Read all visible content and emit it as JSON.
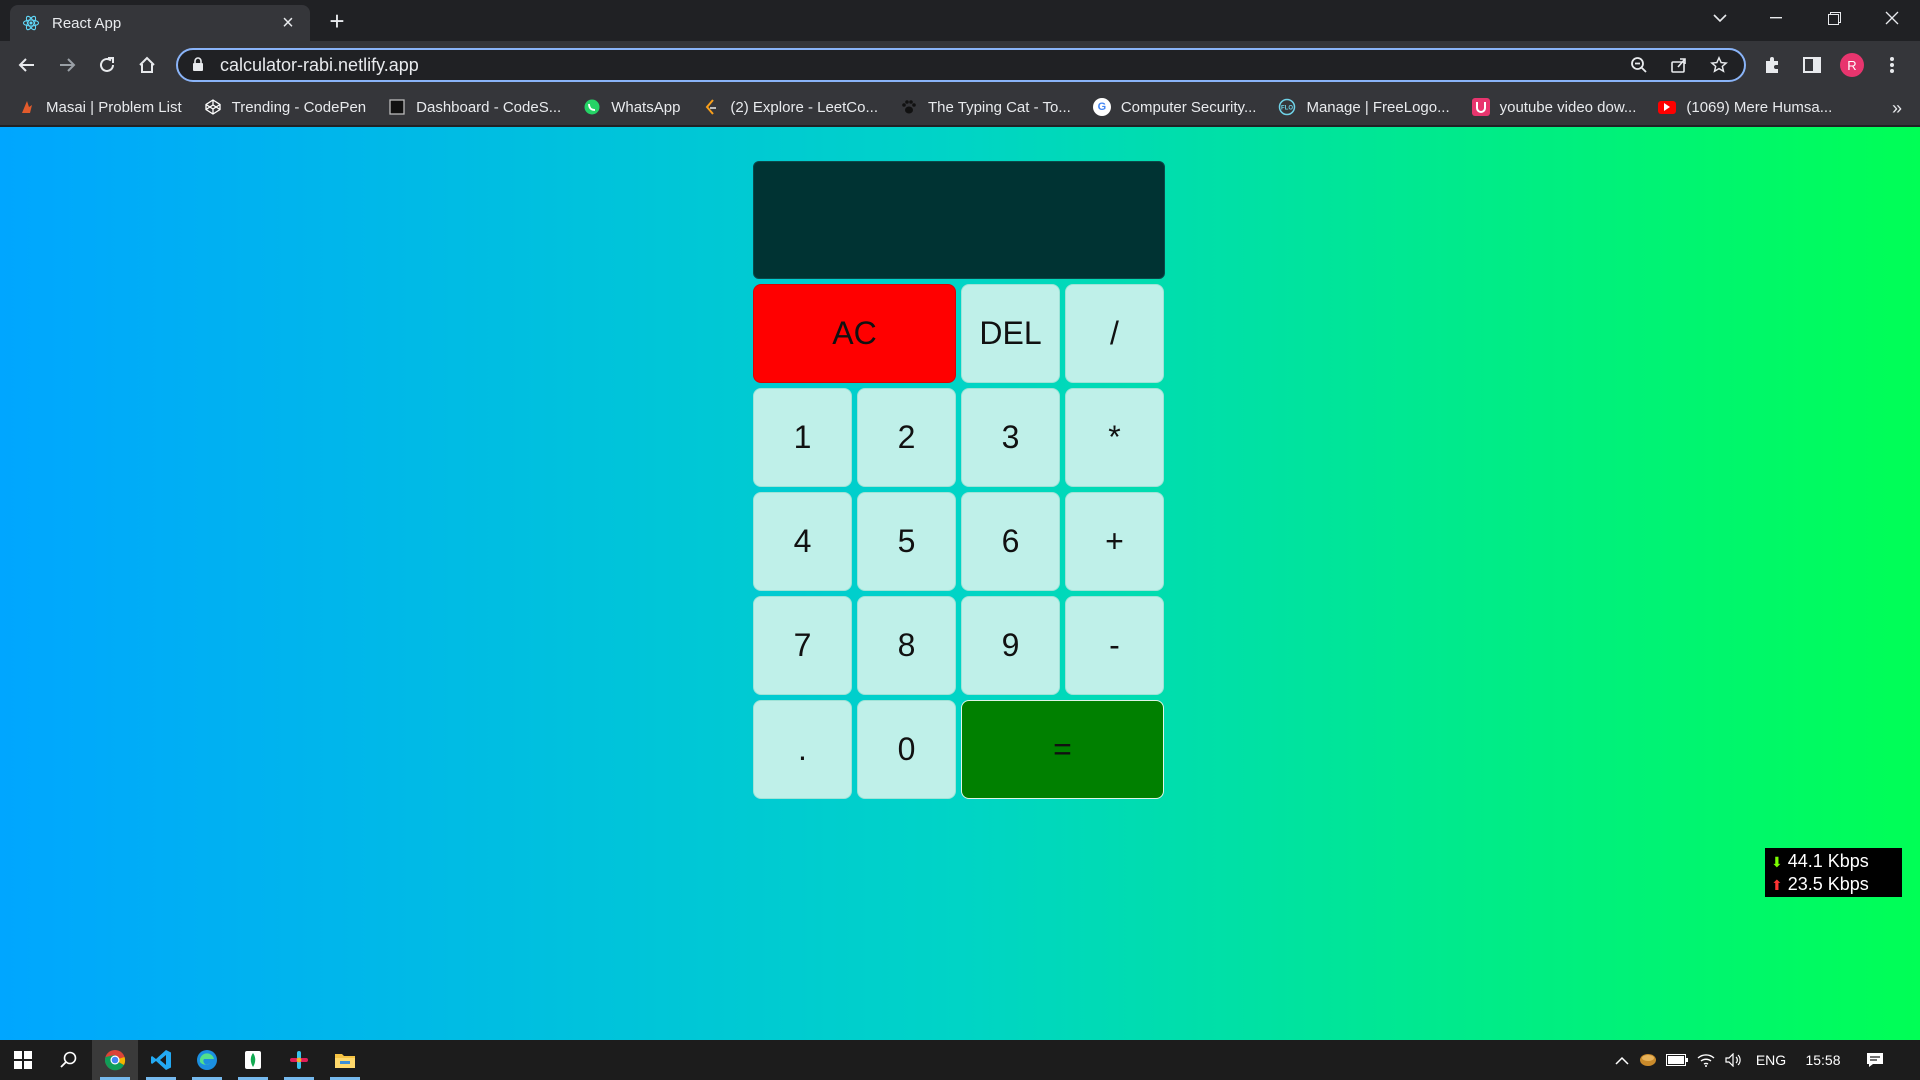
{
  "browser": {
    "tab_title": "React App",
    "url": "calculator-rabi.netlify.app",
    "profile_initial": "R"
  },
  "bookmarks": [
    {
      "label": "Masai | Problem List",
      "icon": "masai-icon",
      "color": "#e25b2c"
    },
    {
      "label": "Trending - CodePen",
      "icon": "codepen-icon",
      "color": "#ffffff"
    },
    {
      "label": "Dashboard - CodeS...",
      "icon": "codesignal-icon",
      "color": "#111111"
    },
    {
      "label": "WhatsApp",
      "icon": "whatsapp-icon",
      "color": "#25d366"
    },
    {
      "label": "(2) Explore - LeetCo...",
      "icon": "leetcode-icon",
      "color": "#f89f1b"
    },
    {
      "label": "The Typing Cat - To...",
      "icon": "paw-icon",
      "color": "#111111"
    },
    {
      "label": "Computer Security...",
      "icon": "google-icon",
      "color": "#ffffff"
    },
    {
      "label": "Manage | FreeLogo...",
      "icon": "freelogo-icon",
      "color": "#1a9bd7"
    },
    {
      "label": "youtube video dow...",
      "icon": "download-icon",
      "color": "#e8356e"
    },
    {
      "label": "(1069) Mere Humsa...",
      "icon": "youtube-icon",
      "color": "#ff0000"
    }
  ],
  "calculator": {
    "display_value": "",
    "keys": [
      {
        "label": "AC",
        "kind": "ac"
      },
      {
        "label": "DEL",
        "kind": "op"
      },
      {
        "label": "/",
        "kind": "op"
      },
      {
        "label": "1",
        "kind": "num"
      },
      {
        "label": "2",
        "kind": "num"
      },
      {
        "label": "3",
        "kind": "num"
      },
      {
        "label": "*",
        "kind": "op"
      },
      {
        "label": "4",
        "kind": "num"
      },
      {
        "label": "5",
        "kind": "num"
      },
      {
        "label": "6",
        "kind": "num"
      },
      {
        "label": "+",
        "kind": "op"
      },
      {
        "label": "7",
        "kind": "num"
      },
      {
        "label": "8",
        "kind": "num"
      },
      {
        "label": "9",
        "kind": "num"
      },
      {
        "label": "-",
        "kind": "op"
      },
      {
        "label": ".",
        "kind": "num"
      },
      {
        "label": "0",
        "kind": "num"
      },
      {
        "label": "=",
        "kind": "eq"
      }
    ],
    "colors": {
      "ac": "#ff0000",
      "eq": "#008000",
      "key": "#bff0e9",
      "display": "#003333"
    }
  },
  "netspeed": {
    "down": "44.1 Kbps",
    "up": "23.5 Kbps"
  },
  "taskbar": {
    "language": "ENG",
    "time": "15:58"
  }
}
